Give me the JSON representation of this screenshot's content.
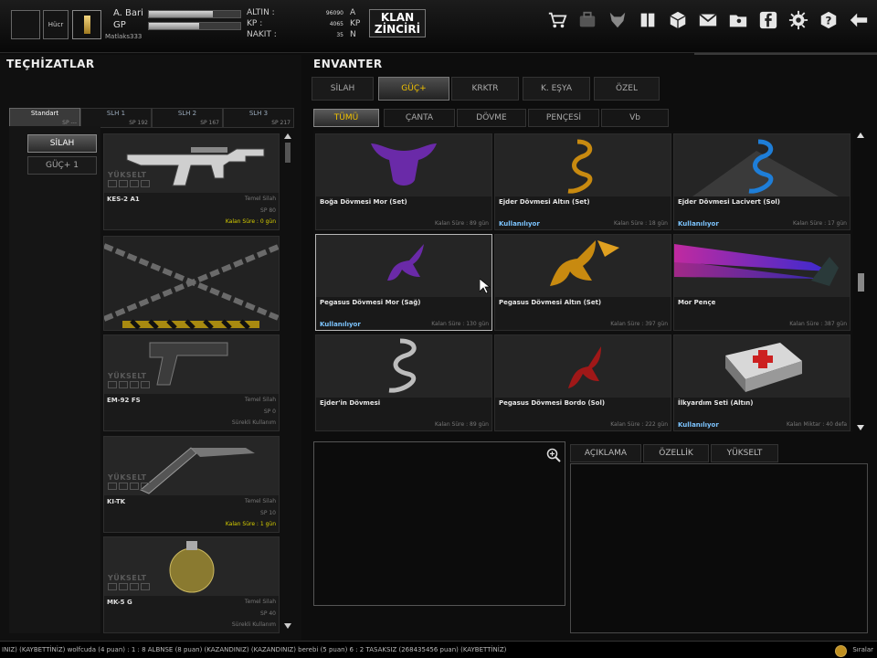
{
  "header": {
    "box2_label": "Hücr",
    "player_name": "A. Bari",
    "gp_label": "GP",
    "player_sub": "Matlaks333",
    "xp_fraction": 0.7,
    "gp_fraction": 0.55,
    "currencies": [
      {
        "value": "96090",
        "unit": "A",
        "name": "ALTIN :"
      },
      {
        "value": "4065",
        "unit": "KP",
        "name": "KP :"
      },
      {
        "value": "35",
        "unit": "N",
        "name": "NAKIT :"
      }
    ],
    "clan_button": "KLAN ZİNCİRİ",
    "icons": [
      "shop-cart-icon",
      "bag-icon",
      "wolf-icon",
      "codex-icon",
      "cube-icon",
      "mail-icon",
      "folder-user-icon",
      "facebook-icon",
      "gear-icon",
      "help-icon",
      "back-arrow-icon"
    ]
  },
  "equipment": {
    "title": "TEÇHİZATLAR",
    "slot_tabs": [
      {
        "label": "Standart",
        "sp": "SP ---"
      },
      {
        "label": "SLH 1",
        "sp": "SP 192"
      },
      {
        "label": "SLH 2",
        "sp": "SP 167"
      },
      {
        "label": "SLH 3",
        "sp": "SP 217"
      }
    ],
    "categories": [
      "SİLAH",
      "GÜÇ+ 1"
    ],
    "items": [
      {
        "name": "KES-2 A1",
        "type": "Temel Silah",
        "sp": "SP 80",
        "remaining": "Kalan Süre : 0 gün",
        "upgrade": "YÜKSELT"
      },
      {
        "name": "",
        "type": "",
        "sp": "",
        "remaining": "",
        "upgrade": ""
      },
      {
        "name": "EM-92 FS",
        "type": "Temel Silah",
        "sp": "SP 0",
        "remaining": "Sürekli Kullanım",
        "upgrade": "YÜKSELT"
      },
      {
        "name": "KI-TK",
        "type": "Temel Silah",
        "sp": "SP 10",
        "remaining": "Kalan Süre : 1 gün",
        "upgrade": "YÜKSELT"
      },
      {
        "name": "MK-5 G",
        "type": "Temel Silah",
        "sp": "SP 40",
        "remaining": "Sürekli Kullanım",
        "upgrade": "YÜKSELT"
      }
    ]
  },
  "inventory": {
    "title": "ENVANTER",
    "tabs": [
      "SİLAH",
      "GÜÇ+",
      "KRKTR",
      "K. EŞYA",
      "ÖZEL"
    ],
    "subtabs": [
      "TÜMÜ",
      "ÇANTA",
      "DÖVME",
      "PENÇESİ",
      "Vb"
    ],
    "items": [
      {
        "name": "Boğa Dövmesi Mor (Set)",
        "status": "",
        "remaining": "Kalan Süre : 89 gün",
        "color": "#6a2aa8"
      },
      {
        "name": "Ejder Dövmesi Altın (Set)",
        "status": "Kullanılıyor",
        "remaining": "Kalan Süre : 18 gün",
        "color": "#c88a10"
      },
      {
        "name": "Ejder Dövmesi Lacivert (Sol)",
        "status": "Kullanılıyor",
        "remaining": "Kalan Süre : 17 gün",
        "color": "#1e7ed8"
      },
      {
        "name": "Pegasus Dövmesi Mor (Sağ)",
        "status": "Kullanılıyor",
        "remaining": "Kalan Süre : 130 gün",
        "color": "#6a2aa8"
      },
      {
        "name": "Pegasus Dövmesi Altın (Set)",
        "status": "",
        "remaining": "Kalan Süre : 397 gün",
        "color": "#c88a10"
      },
      {
        "name": "Mor Pençe",
        "status": "",
        "remaining": "Kalan Süre : 387 gün",
        "color": "#8a30d0"
      },
      {
        "name": "Ejder'in Dövmesi",
        "status": "",
        "remaining": "",
        "color": "#bdbdbd"
      },
      {
        "name": "Pegasus Dövmesi Bordo (Sol)",
        "status": "",
        "remaining": "Kalan Süre : 222 gün",
        "color": "#a01818"
      },
      {
        "name": "İlkyardım Seti (Altın)",
        "status": "Kullanılıyor",
        "remaining": "Kalan Miktar : 40 defa",
        "color": "#cc2020"
      }
    ],
    "detail_tabs": [
      "AÇIKLAMA",
      "ÖZELLİK",
      "YÜKSELT"
    ]
  },
  "ticker": {
    "text": "INIZ)   (KAYBETTİNİZ) wolfcuda (4 puan) : 1 : 8 ALBNSE (8 puan) (KAZANDINIZ)              (KAZANDINIZ) berebi (5 puan) 6 : 2 TASAKSIZ (268435456 puan) (KAYBETTİNİZ)",
    "end_label": "Sıralar"
  }
}
